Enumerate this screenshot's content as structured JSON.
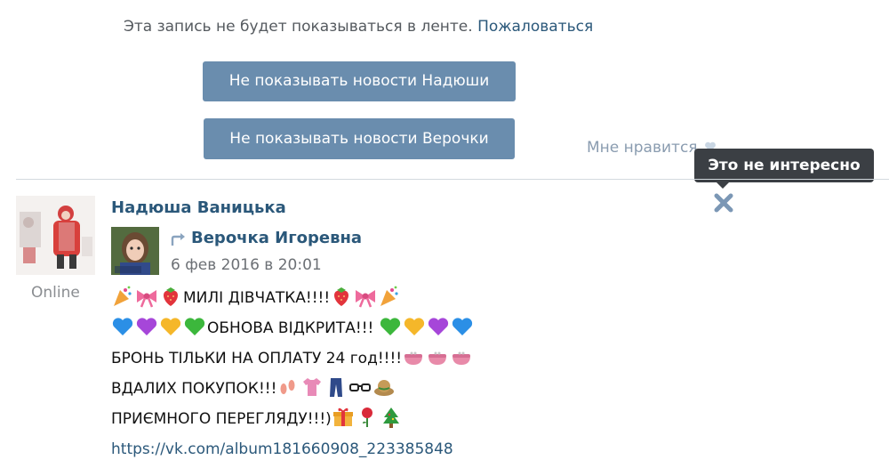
{
  "hidden_note": {
    "text": "Эта запись не будет показываться в ленте.",
    "report_label": "Пожаловаться"
  },
  "buttons": {
    "hide_nadya": "Не показывать новости Надюши",
    "hide_verochka": "Не показывать новости Верочки"
  },
  "like": {
    "label": "Мне нравится"
  },
  "tooltip": {
    "text": "Это не интересно"
  },
  "post": {
    "author": "Надюша Ваницька",
    "author_status": "Online",
    "repost_author": "Верочка Игоревна",
    "date": "6 фев 2016 в 20:01",
    "lines": {
      "l1": "МИЛІ ДІВЧАТКА!!!!",
      "l2": "ОБНОВА ВІДКРИТА!!! ",
      "l3": "БРОНЬ ТІЛЬКИ НА ОПЛАТУ 24 год!!!!",
      "l4": "ВДАЛИХ ПОКУПОК!!!",
      "l5": "ПРИЄМНОГО ПЕРЕГЛЯДУ!!!)"
    },
    "link": "https://vk.com/album181660908_223385848"
  },
  "colors": {
    "link": "#2b587a",
    "button": "#6a8dae",
    "tooltip": "#3b3f44",
    "close_icon": "#7b97b5"
  }
}
